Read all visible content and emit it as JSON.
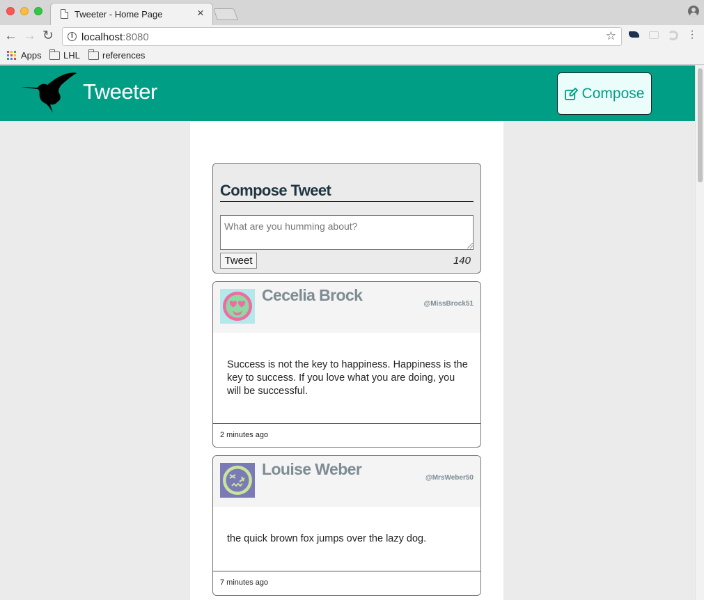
{
  "browser": {
    "tab_title": "Tweeter - Home Page",
    "tab_close": "×",
    "url_host": "localhost",
    "url_port": ":8080",
    "bookmarks": [
      "Apps",
      "LHL",
      "references"
    ]
  },
  "header": {
    "brand": "Tweeter",
    "compose_label": "Compose",
    "color": "#009e84"
  },
  "new_tweet": {
    "heading": "Compose Tweet",
    "placeholder": "What are you humming about?",
    "submit_label": "Tweet",
    "counter": "140"
  },
  "tweets": [
    {
      "name": "Cecelia Brock",
      "handle": "@MissBrock51",
      "text": "Success is not the key to happiness. Happiness is the key to success. If you love what you are doing, you will be successful.",
      "time": "2 minutes ago",
      "avatar_icon": "pink-heart-eyes-face-icon"
    },
    {
      "name": "Louise Weber",
      "handle": "@MrsWeber50",
      "text": "the quick brown fox jumps over the lazy dog.",
      "time": "7 minutes ago",
      "avatar_icon": "dizzy-face-icon"
    }
  ]
}
